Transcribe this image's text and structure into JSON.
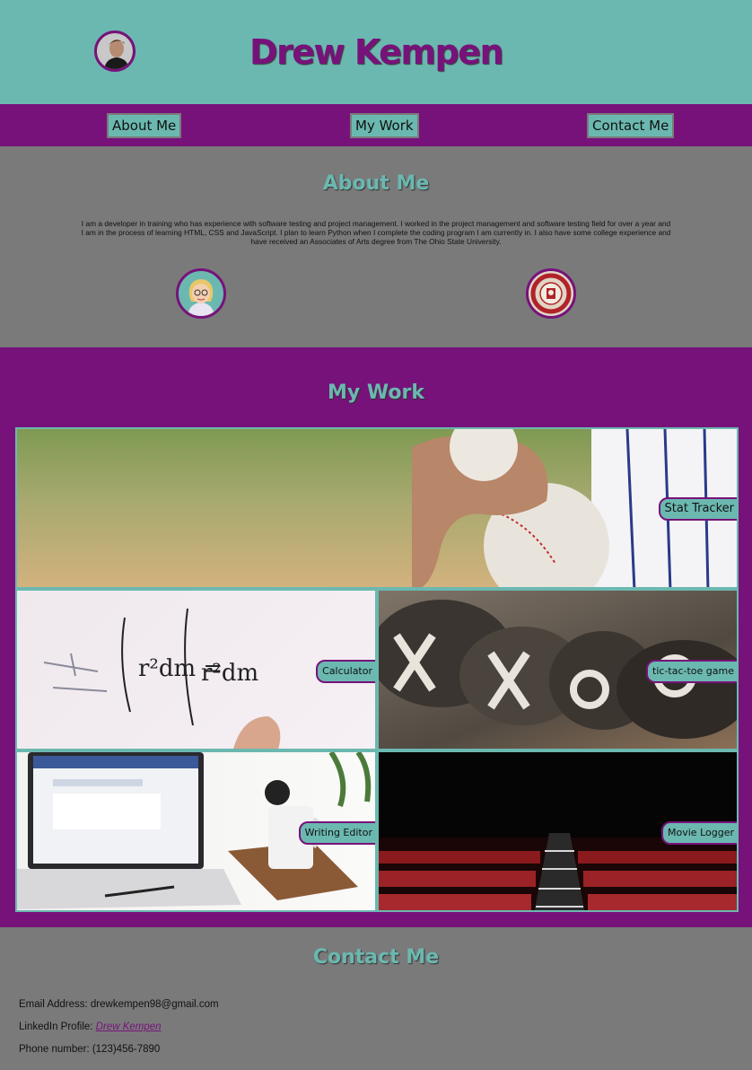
{
  "header": {
    "title": "Drew Kempen",
    "avatar_icon": "profile-photo"
  },
  "nav": {
    "about": "About Me",
    "work": "My Work",
    "contact": "Contact Me"
  },
  "about": {
    "heading": "About Me",
    "text": "I am a developer in training who has experience with software testing and project management. I worked in the project management and software testing field for over a year and I am in the process of learning HTML, CSS and JavaScript. I plan to learn Python when I complete the coding program I am currently in. I also have some college experience and have received an Associates of Arts degree from The Ohio State University.",
    "icons": [
      "cartoon-avatar-icon",
      "university-seal-icon"
    ]
  },
  "work": {
    "heading": "My Work",
    "projects": [
      {
        "label": "Stat Tracker",
        "image": "baseball"
      },
      {
        "label": "Calculator",
        "image": "whiteboard-math"
      },
      {
        "label": "tic-tac-toe game",
        "image": "beanbags-xo"
      },
      {
        "label": "Writing Editor",
        "image": "laptop-desk"
      },
      {
        "label": "Movie Logger",
        "image": "theater-seats"
      }
    ]
  },
  "contact": {
    "heading": "Contact Me",
    "email_label": "Email Address: drewkempen98@gmail.com",
    "linkedin_prefix": "LinkedIn Profile:",
    "linkedin_link": "Drew Kempen",
    "phone_label": "Phone number: (123)456-7890"
  },
  "colors": {
    "teal": "#6bb8b0",
    "purple": "#77127a",
    "gray": "#7a7a7a"
  }
}
